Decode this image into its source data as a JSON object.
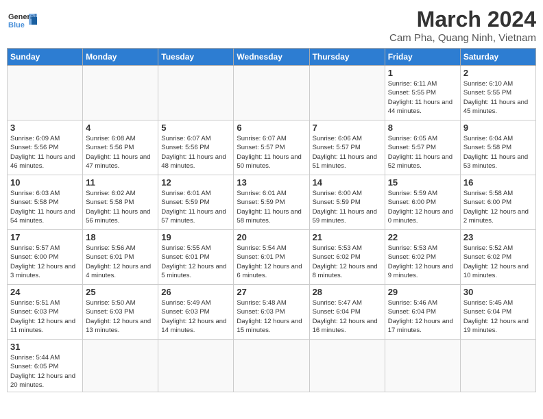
{
  "header": {
    "logo_text_general": "General",
    "logo_text_blue": "Blue",
    "month_year": "March 2024",
    "location": "Cam Pha, Quang Ninh, Vietnam"
  },
  "days_of_week": [
    "Sunday",
    "Monday",
    "Tuesday",
    "Wednesday",
    "Thursday",
    "Friday",
    "Saturday"
  ],
  "weeks": [
    {
      "days": [
        {
          "num": "",
          "empty": true
        },
        {
          "num": "",
          "empty": true
        },
        {
          "num": "",
          "empty": true
        },
        {
          "num": "",
          "empty": true
        },
        {
          "num": "",
          "empty": true
        },
        {
          "num": "1",
          "sunrise": "6:11 AM",
          "sunset": "5:55 PM",
          "daylight": "11 hours and 44 minutes."
        },
        {
          "num": "2",
          "sunrise": "6:10 AM",
          "sunset": "5:55 PM",
          "daylight": "11 hours and 45 minutes."
        }
      ]
    },
    {
      "days": [
        {
          "num": "3",
          "sunrise": "6:09 AM",
          "sunset": "5:56 PM",
          "daylight": "11 hours and 46 minutes."
        },
        {
          "num": "4",
          "sunrise": "6:08 AM",
          "sunset": "5:56 PM",
          "daylight": "11 hours and 47 minutes."
        },
        {
          "num": "5",
          "sunrise": "6:07 AM",
          "sunset": "5:56 PM",
          "daylight": "11 hours and 48 minutes."
        },
        {
          "num": "6",
          "sunrise": "6:07 AM",
          "sunset": "5:57 PM",
          "daylight": "11 hours and 50 minutes."
        },
        {
          "num": "7",
          "sunrise": "6:06 AM",
          "sunset": "5:57 PM",
          "daylight": "11 hours and 51 minutes."
        },
        {
          "num": "8",
          "sunrise": "6:05 AM",
          "sunset": "5:57 PM",
          "daylight": "11 hours and 52 minutes."
        },
        {
          "num": "9",
          "sunrise": "6:04 AM",
          "sunset": "5:58 PM",
          "daylight": "11 hours and 53 minutes."
        }
      ]
    },
    {
      "days": [
        {
          "num": "10",
          "sunrise": "6:03 AM",
          "sunset": "5:58 PM",
          "daylight": "11 hours and 54 minutes."
        },
        {
          "num": "11",
          "sunrise": "6:02 AM",
          "sunset": "5:58 PM",
          "daylight": "11 hours and 56 minutes."
        },
        {
          "num": "12",
          "sunrise": "6:01 AM",
          "sunset": "5:59 PM",
          "daylight": "11 hours and 57 minutes."
        },
        {
          "num": "13",
          "sunrise": "6:01 AM",
          "sunset": "5:59 PM",
          "daylight": "11 hours and 58 minutes."
        },
        {
          "num": "14",
          "sunrise": "6:00 AM",
          "sunset": "5:59 PM",
          "daylight": "11 hours and 59 minutes."
        },
        {
          "num": "15",
          "sunrise": "5:59 AM",
          "sunset": "6:00 PM",
          "daylight": "12 hours and 0 minutes."
        },
        {
          "num": "16",
          "sunrise": "5:58 AM",
          "sunset": "6:00 PM",
          "daylight": "12 hours and 2 minutes."
        }
      ]
    },
    {
      "days": [
        {
          "num": "17",
          "sunrise": "5:57 AM",
          "sunset": "6:00 PM",
          "daylight": "12 hours and 3 minutes."
        },
        {
          "num": "18",
          "sunrise": "5:56 AM",
          "sunset": "6:01 PM",
          "daylight": "12 hours and 4 minutes."
        },
        {
          "num": "19",
          "sunrise": "5:55 AM",
          "sunset": "6:01 PM",
          "daylight": "12 hours and 5 minutes."
        },
        {
          "num": "20",
          "sunrise": "5:54 AM",
          "sunset": "6:01 PM",
          "daylight": "12 hours and 6 minutes."
        },
        {
          "num": "21",
          "sunrise": "5:53 AM",
          "sunset": "6:02 PM",
          "daylight": "12 hours and 8 minutes."
        },
        {
          "num": "22",
          "sunrise": "5:53 AM",
          "sunset": "6:02 PM",
          "daylight": "12 hours and 9 minutes."
        },
        {
          "num": "23",
          "sunrise": "5:52 AM",
          "sunset": "6:02 PM",
          "daylight": "12 hours and 10 minutes."
        }
      ]
    },
    {
      "days": [
        {
          "num": "24",
          "sunrise": "5:51 AM",
          "sunset": "6:03 PM",
          "daylight": "12 hours and 11 minutes."
        },
        {
          "num": "25",
          "sunrise": "5:50 AM",
          "sunset": "6:03 PM",
          "daylight": "12 hours and 13 minutes."
        },
        {
          "num": "26",
          "sunrise": "5:49 AM",
          "sunset": "6:03 PM",
          "daylight": "12 hours and 14 minutes."
        },
        {
          "num": "27",
          "sunrise": "5:48 AM",
          "sunset": "6:03 PM",
          "daylight": "12 hours and 15 minutes."
        },
        {
          "num": "28",
          "sunrise": "5:47 AM",
          "sunset": "6:04 PM",
          "daylight": "12 hours and 16 minutes."
        },
        {
          "num": "29",
          "sunrise": "5:46 AM",
          "sunset": "6:04 PM",
          "daylight": "12 hours and 17 minutes."
        },
        {
          "num": "30",
          "sunrise": "5:45 AM",
          "sunset": "6:04 PM",
          "daylight": "12 hours and 19 minutes."
        }
      ]
    },
    {
      "days": [
        {
          "num": "31",
          "sunrise": "5:44 AM",
          "sunset": "6:05 PM",
          "daylight": "12 hours and 20 minutes."
        },
        {
          "num": "",
          "empty": true
        },
        {
          "num": "",
          "empty": true
        },
        {
          "num": "",
          "empty": true
        },
        {
          "num": "",
          "empty": true
        },
        {
          "num": "",
          "empty": true
        },
        {
          "num": "",
          "empty": true
        }
      ]
    }
  ]
}
